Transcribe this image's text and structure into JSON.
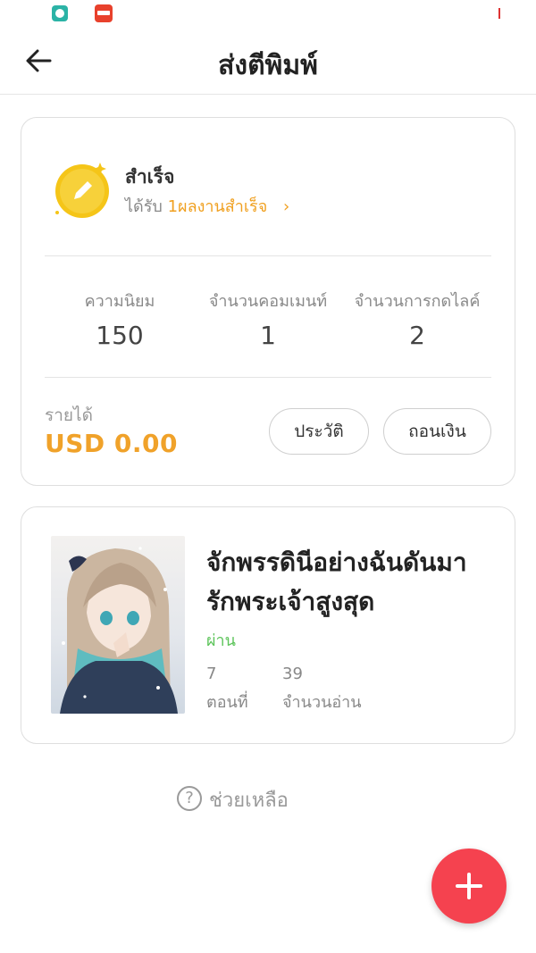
{
  "header": {
    "title": "ส่งตีพิมพ์",
    "back_icon": "arrow-left-icon"
  },
  "stats_card": {
    "status_label": "สำเร็จ",
    "status_prefix": "ได้รับ",
    "status_count_text": "1ผลงานสำเร็จ",
    "status_chevron": "›",
    "stats": [
      {
        "label": "ความนิยม",
        "value": "150"
      },
      {
        "label": "จำนวนคอมเมนท์",
        "value": "1"
      },
      {
        "label": "จำนวนการกดไลค์",
        "value": "2"
      }
    ],
    "income_label": "รายได้",
    "income_value": "USD 0.00",
    "history_button": "ประวัติ",
    "withdraw_button": "ถอนเงิน"
  },
  "work": {
    "title": "จักพรรดินีอย่างฉันดันมารักพระเจ้าสูงสุด",
    "status": "ผ่าน",
    "episodes_value": "7",
    "episodes_label": "ตอนที่",
    "reads_value": "39",
    "reads_label": "จำนวนอ่าน"
  },
  "help": {
    "icon": "?",
    "label": "ช่วยเหลือ"
  },
  "colors": {
    "accent_orange": "#f0a22a",
    "status_green": "#5cc45a",
    "fab_red": "#f5424f",
    "coin_gold": "#f5c518"
  }
}
